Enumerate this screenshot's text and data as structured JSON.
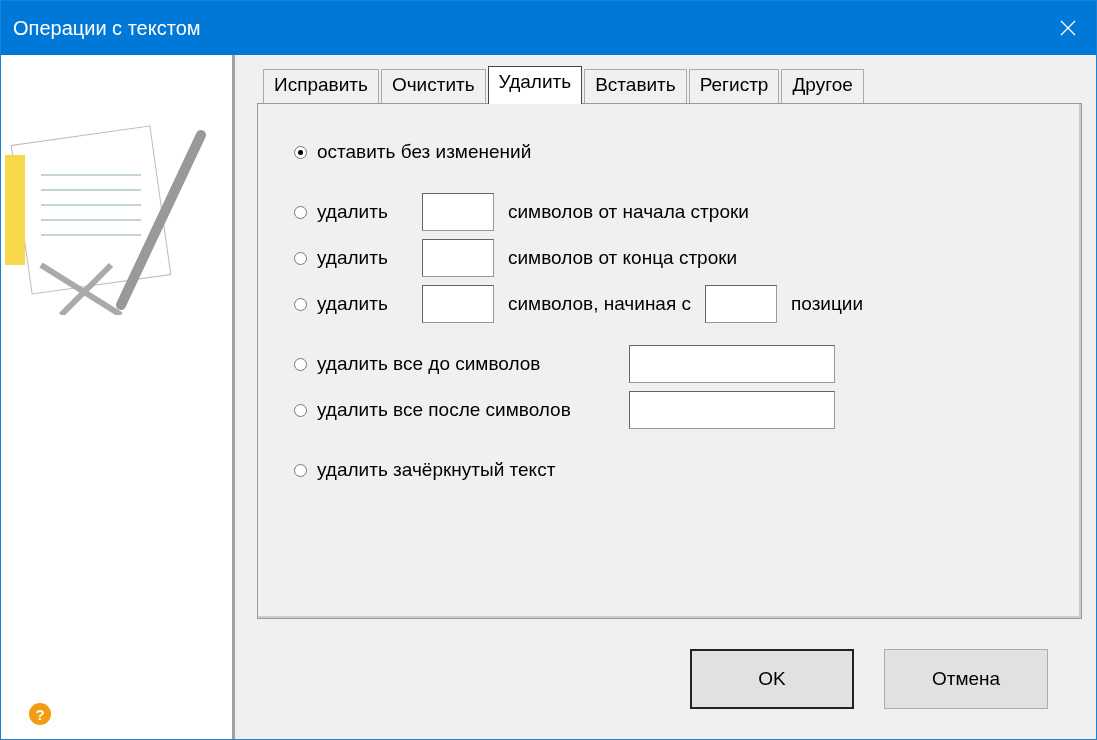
{
  "window": {
    "title": "Операции с текстом"
  },
  "tabs": [
    {
      "label": "Исправить",
      "selected": false
    },
    {
      "label": "Очистить",
      "selected": false
    },
    {
      "label": "Удалить",
      "selected": true
    },
    {
      "label": "Вставить",
      "selected": false
    },
    {
      "label": "Регистр",
      "selected": false
    },
    {
      "label": "Другое",
      "selected": false
    }
  ],
  "option_groups": [
    {
      "options": [
        {
          "kind": "plain",
          "label": "оставить без изменений",
          "selected": true
        }
      ]
    },
    {
      "options": [
        {
          "kind": "count",
          "label": "удалить",
          "suffix": "символов от начала строки",
          "selected": false
        },
        {
          "kind": "count",
          "label": "удалить",
          "suffix": "символов от конца строки",
          "selected": false
        },
        {
          "kind": "count_position",
          "label": "удалить",
          "middle": "символов, начиная с",
          "suffix": "позиции",
          "selected": false
        }
      ]
    },
    {
      "options": [
        {
          "kind": "chars",
          "label": "удалить все до символов",
          "selected": false
        },
        {
          "kind": "chars",
          "label": "удалить все после символов",
          "selected": false
        }
      ]
    },
    {
      "options": [
        {
          "kind": "plain",
          "label": "удалить зачёркнутый текст",
          "selected": false
        }
      ]
    }
  ],
  "help": "?",
  "buttons": [
    {
      "label": "OK",
      "default": true
    },
    {
      "label": "Отмена",
      "default": false
    }
  ]
}
